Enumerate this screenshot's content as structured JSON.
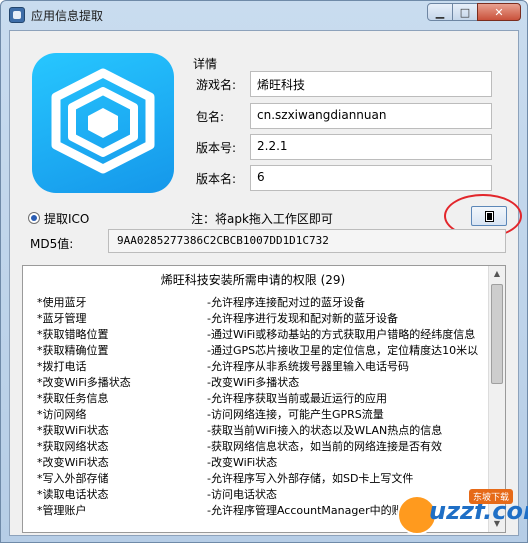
{
  "window": {
    "title": "应用信息提取",
    "minimize": "▁",
    "maximize": "□",
    "close": "✕"
  },
  "details": {
    "group_label": "详情",
    "fields": [
      {
        "label": "游戏名:",
        "value": "烯旺科技"
      },
      {
        "label": "包名:",
        "value": "cn.szxiwangdiannuan"
      },
      {
        "label": "版本号:",
        "value": "2.2.1"
      },
      {
        "label": "版本名:",
        "value": "6"
      }
    ]
  },
  "extract_ico": {
    "label": "提取ICO",
    "checked": true
  },
  "note": "注：将apk拖入工作区即可",
  "copy_button_icon": "copy-icon",
  "md5": {
    "label": "MD5值:",
    "value": "9AA0285277386C2CBCB1007DD1D1C732"
  },
  "permissions": {
    "header": "烯旺科技安装所需申请的权限 (29)",
    "items": [
      {
        "name": "*使用蓝牙",
        "desc": "-允许程序连接配对过的蓝牙设备"
      },
      {
        "name": "*蓝牙管理",
        "desc": "-允许程序进行发现和配对新的蓝牙设备"
      },
      {
        "name": "*获取错略位置",
        "desc": "-通过WiFi或移动基站的方式获取用户错略的经纬度信息"
      },
      {
        "name": "*获取精确位置",
        "desc": "-通过GPS芯片接收卫星的定位信息，定位精度达10米以"
      },
      {
        "name": "*拨打电话",
        "desc": "-允许程序从非系统拨号器里输入电话号码"
      },
      {
        "name": "*改变WiFi多播状态",
        "desc": "-改变WiFi多播状态"
      },
      {
        "name": "*获取任务信息",
        "desc": "-允许程序获取当前或最近运行的应用"
      },
      {
        "name": "*访问网络",
        "desc": "-访问网络连接，可能产生GPRS流量"
      },
      {
        "name": "*获取WiFi状态",
        "desc": "-获取当前WiFi接入的状态以及WLAN热点的信息"
      },
      {
        "name": "*获取网络状态",
        "desc": "-获取网络信息状态，如当前的网络连接是否有效"
      },
      {
        "name": "*改变WiFi状态",
        "desc": "-改变WiFi状态"
      },
      {
        "name": "*写入外部存储",
        "desc": "-允许程序写入外部存储，如SD卡上写文件"
      },
      {
        "name": "*读取电话状态",
        "desc": "-访问电话状态"
      },
      {
        "name": "*管理账户",
        "desc": "-允许程序管理AccountManager中的账户列表"
      }
    ]
  },
  "watermark": {
    "text": "uzzf.com",
    "badge": "东坡下载"
  },
  "colors": {
    "logo": "#1aa7f0",
    "accent": "#2a5db3",
    "annotation": "#e2262b"
  }
}
